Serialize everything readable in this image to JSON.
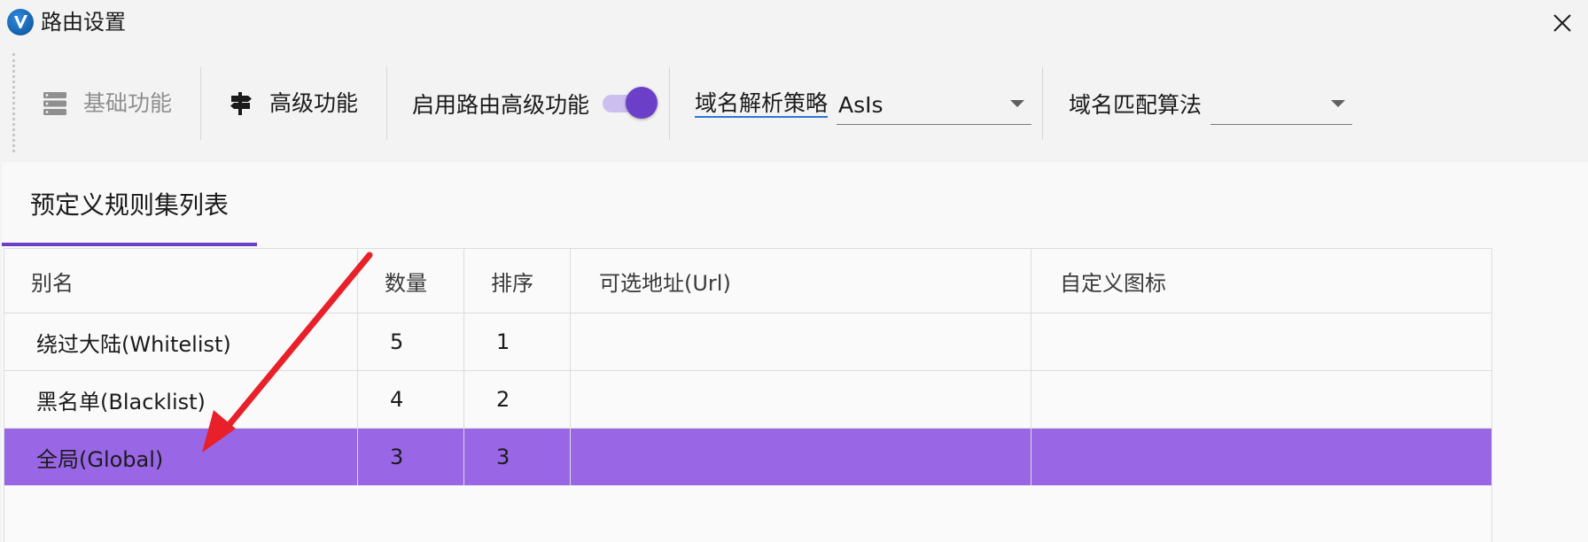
{
  "window": {
    "title": "路由设置",
    "app_icon": "v-logo-icon",
    "close_icon": "close-icon"
  },
  "toolbar": {
    "basic_label": "基础功能",
    "basic_icon": "server-list-icon",
    "advanced_label": "高级功能",
    "advanced_icon": "signpost-icon",
    "enable_label": "启用路由高级功能",
    "enable_on": true,
    "dns_strategy_label": "域名解析策略",
    "dns_strategy_value": "AsIs",
    "match_algo_label": "域名匹配算法",
    "match_algo_value": ""
  },
  "tab": {
    "label": "预定义规则集列表"
  },
  "table": {
    "columns": [
      "别名",
      "数量",
      "排序",
      "可选地址(Url)",
      "自定义图标"
    ],
    "rows": [
      {
        "alias": "绕过大陆(Whitelist)",
        "count": "5",
        "order": "1",
        "url": "",
        "icon": ""
      },
      {
        "alias": "黑名单(Blacklist)",
        "count": "4",
        "order": "2",
        "url": "",
        "icon": ""
      },
      {
        "alias": "全局(Global)",
        "count": "3",
        "order": "3",
        "url": "",
        "icon": ""
      }
    ],
    "selected_index": 2
  },
  "colors": {
    "accent": "#6c3fc9",
    "selected_row": "#9966e6",
    "annotation_arrow": "#e8202a"
  }
}
